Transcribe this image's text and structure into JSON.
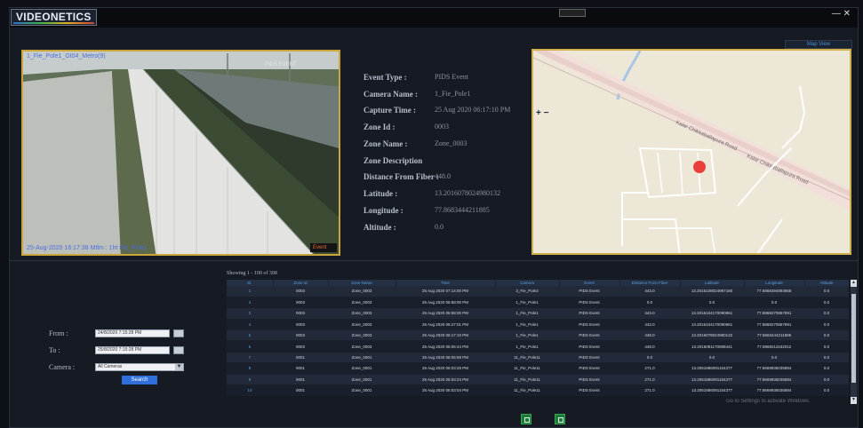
{
  "app": {
    "logo": "VIDEONETICS",
    "win_controls": "— ✕"
  },
  "camera": {
    "overlay_top": "1_Fie_Pole1_Gt04_Metro(9)",
    "overlay_top_right": "PIDS EVENT",
    "overlay_bottom": "25-Aug-2020 16:17:38  Mtlm : 1ht Fie_Pole1",
    "badge": "Event"
  },
  "details": [
    {
      "label": "Event Type :",
      "value": "PIDS Event"
    },
    {
      "label": "Camera Name :",
      "value": "1_Fie_Pole1"
    },
    {
      "label": "Capture Time :",
      "value": "25 Aug 2020 06:17:10 PM"
    },
    {
      "label": "Zone Id :",
      "value": "0003"
    },
    {
      "label": "Zone Name :",
      "value": "Zone_0003"
    },
    {
      "label": "Zone Description",
      "value": ""
    },
    {
      "label": "Distance From Fiber :",
      "value": "448.0"
    },
    {
      "label": "Latitude :",
      "value": "13.2016078024980132"
    },
    {
      "label": "Longitude :",
      "value": "77.8683444211885"
    },
    {
      "label": "Altitude :",
      "value": "0.0"
    }
  ],
  "map": {
    "view_button": "Map View",
    "zoom": "+ −",
    "road_label_1": "Kalar Chikkaballapura Road",
    "road_label_2": "Kalar Chikkaballapura Road",
    "marker_color": "#e8413c"
  },
  "search": {
    "from_label": "From :",
    "from_value": "24/8/2020 7:15:28 PM",
    "to_label": "To :",
    "to_value": "25/8/2020 7:15:28 PM",
    "camera_label": "Camera :",
    "camera_value": "All Cameras",
    "search_button": "Search"
  },
  "table": {
    "showing": "Showing 1 - 100 of 308",
    "columns": [
      "Sl.",
      "Zone Id",
      "Zone Name",
      "Time",
      "Camera",
      "Event",
      "Distance From Fiber",
      "Latitude",
      "Longitude",
      "Altitude"
    ],
    "rows": [
      [
        "1",
        "0003",
        "Zone_0003",
        "25 Aug 2020 07:14:00 PM",
        "3_Fie_Pole3",
        "PIDS Event",
        "443.0",
        "13.2016108024987180",
        "77.8868394893868",
        "0.0"
      ],
      [
        "2",
        "0003",
        "Zone_0003",
        "25 Aug 2020 06:58:00 PM",
        "1_Fie_Pole1",
        "PIDS Event",
        "0.0",
        "0.0",
        "0.0",
        "0.0"
      ],
      [
        "3",
        "0003",
        "Zone_0003",
        "25 Aug 2020 06:58:00 PM",
        "1_Fie_Pole1",
        "PIDS Event",
        "443.0",
        "13.2016104170090861",
        "77.8868270857891",
        "0.0"
      ],
      [
        "4",
        "0003",
        "Zone_0003",
        "25 Aug 2020 06:27:01 PM",
        "1_Fie_Pole1",
        "PIDS Event",
        "443.0",
        "13.2016104170090861",
        "77.8868270857891",
        "0.0"
      ],
      [
        "5",
        "0003",
        "Zone_0003",
        "25 Aug 2020 06:17:10 PM",
        "1_Fie_Pole1",
        "PIDS Event",
        "448.0",
        "13.2016078024980132",
        "77.8683444211885",
        "0.0"
      ],
      [
        "6",
        "0003",
        "Zone_0003",
        "25 Aug 2020 06:06:44 PM",
        "1_Fie_Pole1",
        "PIDS Event",
        "448.0",
        "13.2016081170089441",
        "77.8868211532012",
        "0.0"
      ],
      [
        "7",
        "0001",
        "Zone_0001",
        "25 Aug 2020 06:05:59 PM",
        "11_Fie_Pole11",
        "PIDS Event",
        "0.0",
        "0.0",
        "0.0",
        "0.0"
      ],
      [
        "8",
        "0001",
        "Zone_0001",
        "25 Aug 2020 06:03:25 PM",
        "11_Fie_Pole11",
        "PIDS Event",
        "271.0",
        "13.2061886091154377",
        "77.8669936035884",
        "0.0"
      ],
      [
        "9",
        "0001",
        "Zone_0001",
        "25 Aug 2020 06:03:24 PM",
        "11_Fie_Pole11",
        "PIDS Event",
        "271.0",
        "13.2061886091154377",
        "77.8669936035884",
        "0.0"
      ],
      [
        "10",
        "0001",
        "Zone_0001",
        "25 Aug 2020 06:03:04 PM",
        "11_Fie_Pole11",
        "PIDS Event",
        "271.0",
        "13.2061886091154377",
        "77.8669936035884",
        "0.0"
      ]
    ]
  },
  "watermark": "Go to Settings to activate Windows."
}
